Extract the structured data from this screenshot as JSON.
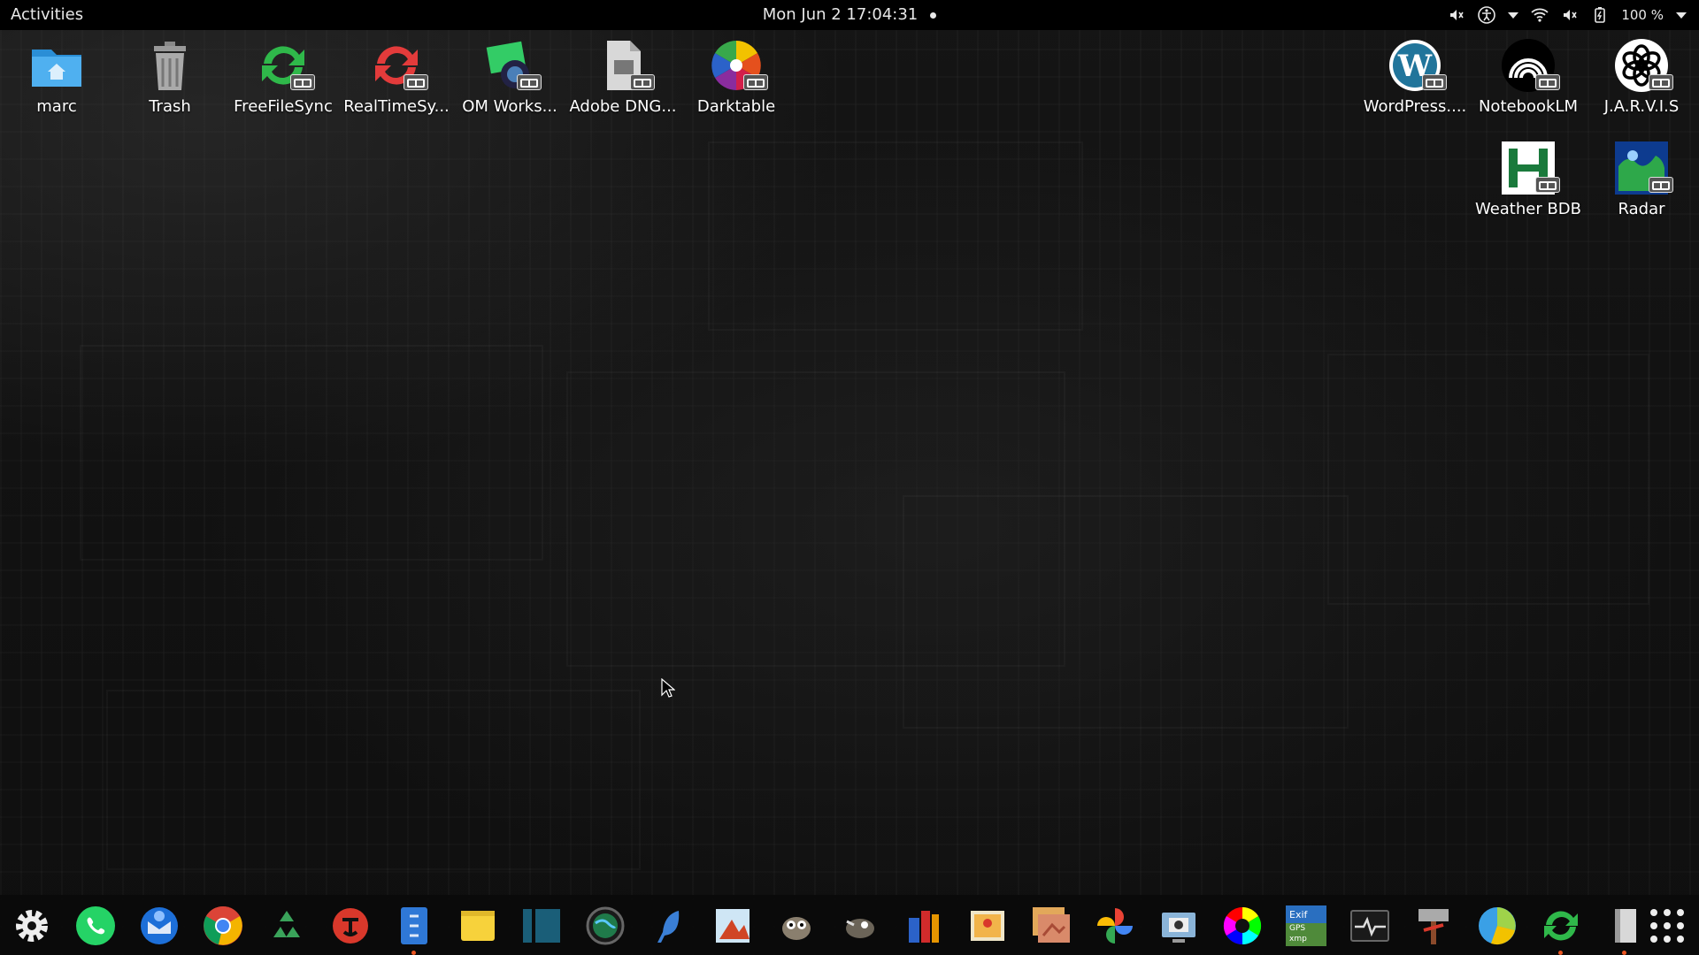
{
  "topbar": {
    "activities": "Activities",
    "datetime": "Mon Jun 2  17:04:31",
    "battery_percent": "100 %"
  },
  "desktop_icons": [
    {
      "name": "home-folder",
      "label": "marc"
    },
    {
      "name": "trash",
      "label": "Trash"
    },
    {
      "name": "freefilesync",
      "label": "FreeFileSync"
    },
    {
      "name": "realtimesync",
      "label": "RealTimeSy..."
    },
    {
      "name": "om-workspace",
      "label": "OM Works..."
    },
    {
      "name": "adobe-dng",
      "label": "Adobe DNG..."
    },
    {
      "name": "darktable",
      "label": "Darktable"
    },
    {
      "name": "wordpress",
      "label": "WordPress...."
    },
    {
      "name": "notebooklm",
      "label": "NotebookLM"
    },
    {
      "name": "jarvis",
      "label": "J.A.R.V.I.S"
    },
    {
      "name": "weather-bdb",
      "label": "Weather BDB"
    },
    {
      "name": "radar",
      "label": "Radar"
    }
  ],
  "dock": {
    "items": [
      "settings",
      "whatsapp",
      "thunderbird",
      "chrome",
      "recycle",
      "tux-app",
      "files",
      "notes",
      "frame-app",
      "globe",
      "feather",
      "photo-editor",
      "gimp",
      "inkscape-like",
      "library",
      "image-viewer",
      "slides",
      "pinwheel",
      "screenshot",
      "color-wheel",
      "exif-gps-xmp",
      "system-monitor",
      "hammer-tool",
      "pie-app",
      "sync",
      "disk",
      "app-grid"
    ],
    "exif_label_1": "Exif",
    "exif_label_2": "GPS",
    "exif_label_3": "xmp"
  }
}
